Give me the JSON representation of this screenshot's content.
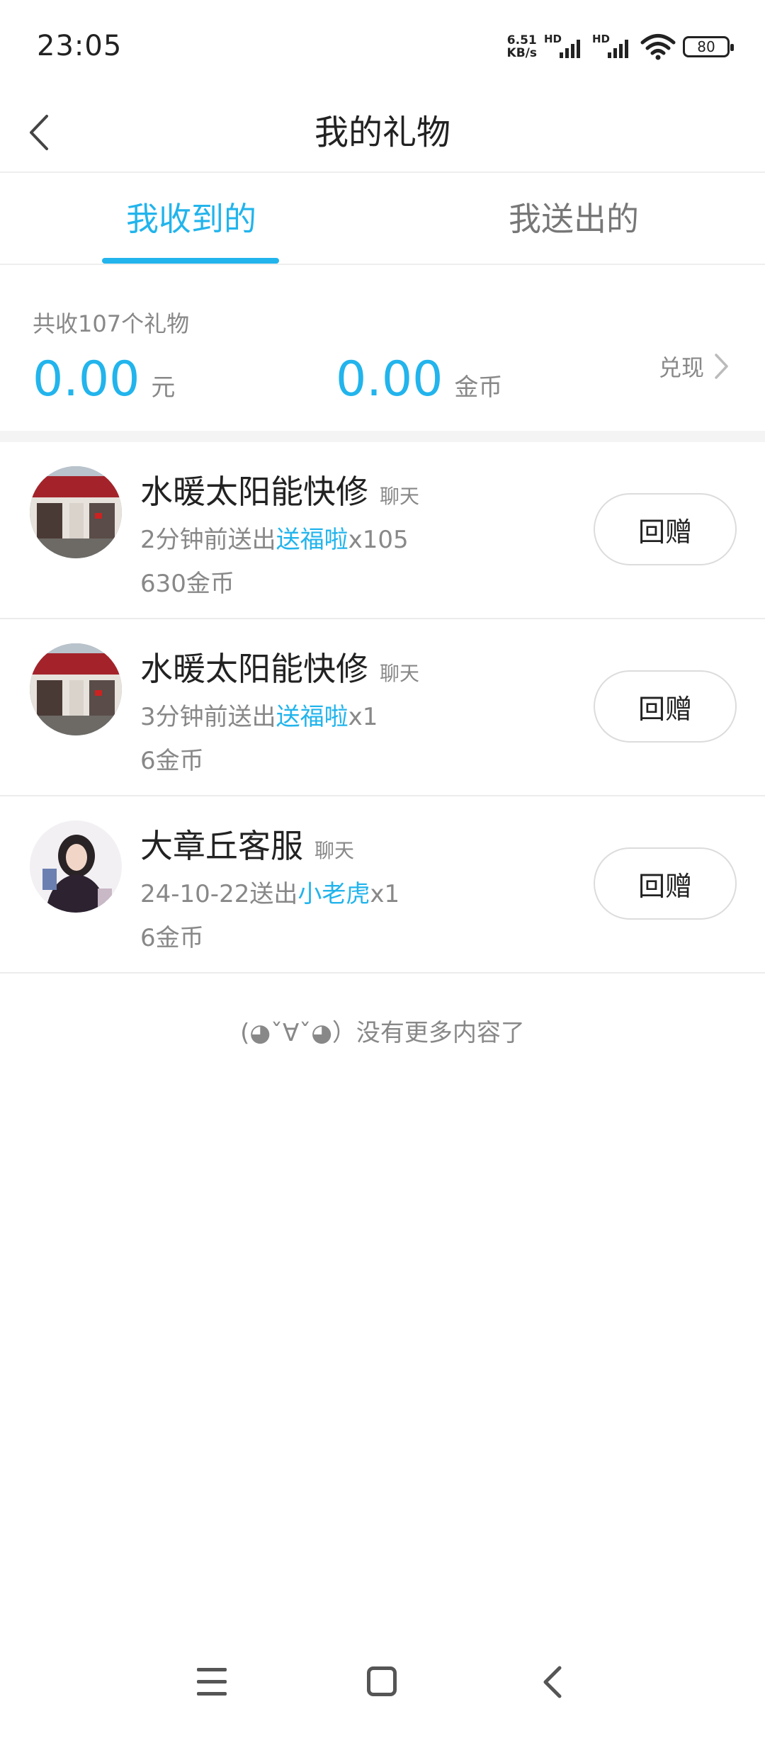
{
  "status": {
    "time": "23:05",
    "net_speed_value": "6.51",
    "net_speed_unit": "KB/s",
    "sim_label": "HD",
    "battery": "80"
  },
  "header": {
    "title": "我的礼物"
  },
  "tabs": [
    {
      "label": "我收到的",
      "active": true
    },
    {
      "label": "我送出的",
      "active": false
    }
  ],
  "summary": {
    "total_text": "共收107个礼物",
    "cash_value": "0.00",
    "cash_unit": "元",
    "coin_value": "0.00",
    "coin_unit": "金币",
    "withdraw_label": "兑现"
  },
  "gifts": [
    {
      "name": "水暖太阳能快修",
      "chat_label": "聊天",
      "time_prefix": "2分钟前送出",
      "gift_name": "送福啦",
      "quantity": "x105",
      "coins": "630金币",
      "button_label": "回赠"
    },
    {
      "name": "水暖太阳能快修",
      "chat_label": "聊天",
      "time_prefix": "3分钟前送出",
      "gift_name": "送福啦",
      "quantity": "x1",
      "coins": "6金币",
      "button_label": "回赠"
    },
    {
      "name": "大章丘客服",
      "chat_label": "聊天",
      "time_prefix": "24-10-22送出",
      "gift_name": "小老虎",
      "quantity": "x1",
      "coins": "6金币",
      "button_label": "回赠"
    }
  ],
  "no_more_text": "(◕ˇ∀ˇ◕）没有更多内容了",
  "colors": {
    "accent": "#22b4ec",
    "muted": "#888888",
    "text": "#222222"
  }
}
